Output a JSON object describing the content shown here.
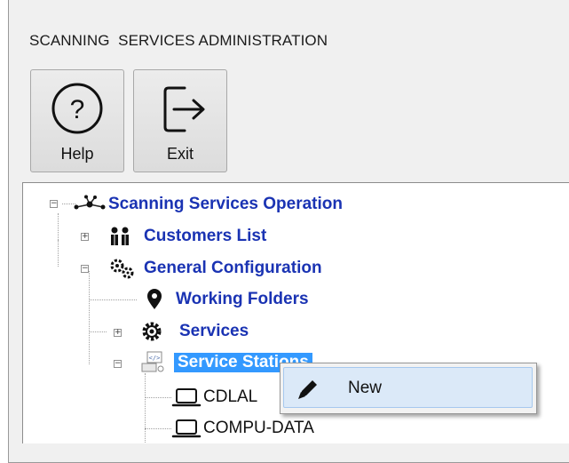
{
  "window": {
    "title": "SCANNING  SERVICES ADMINISTRATION"
  },
  "toolbar": {
    "help_label": "Help",
    "exit_label": "Exit"
  },
  "tree": {
    "root": "Scanning Services Operation",
    "customers": "Customers List",
    "general_config": "General Configuration",
    "working_folders": "Working Folders",
    "services": "Services",
    "service_stations": "Service Stations",
    "stations": [
      "CDLAL",
      "COMPU-DATA"
    ]
  },
  "context_menu": {
    "new_label": "New"
  },
  "colors": {
    "node_text": "#1a33b3",
    "selection": "#3399ff",
    "menu_highlight": "#dbe9f8"
  }
}
